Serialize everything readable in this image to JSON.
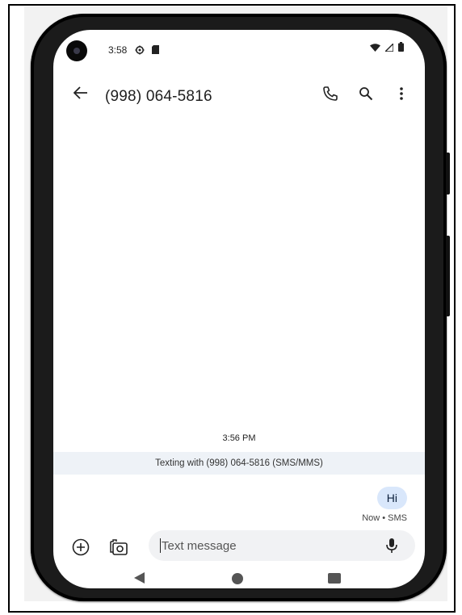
{
  "status_bar": {
    "time": "3:58"
  },
  "conversation": {
    "title": "(998) 064-5816",
    "timestamp": "3:56 PM",
    "banner": "Texting with (998) 064-5816 (SMS/MMS)",
    "messages": [
      {
        "text": "Hi",
        "meta": "Now • SMS",
        "direction": "outgoing"
      }
    ]
  },
  "composer": {
    "placeholder": "Text message"
  },
  "colors": {
    "bubble_outgoing": "#d9e7fb",
    "banner_bg": "#eef2f7",
    "composer_bg": "#f1f2f4"
  }
}
